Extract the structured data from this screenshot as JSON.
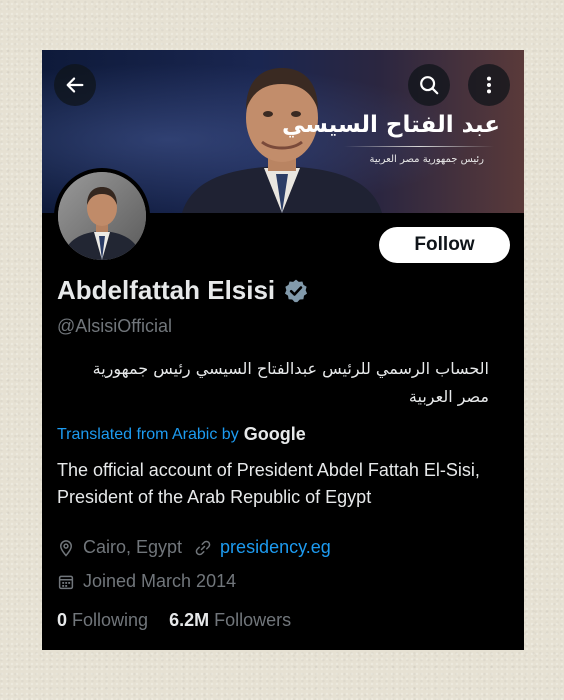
{
  "header": {
    "back_icon": "arrow-left-icon",
    "search_icon": "search-icon",
    "more_icon": "more-vertical-icon"
  },
  "banner": {
    "name_ar": "عبد الفتاح السيسي",
    "subtitle_ar": "رئيس جمهورية مصر العربية"
  },
  "profile": {
    "display_name": "Abdelfattah Elsisi",
    "verified_icon": "verified-badge-icon",
    "handle": "@AlsisiOfficial",
    "follow_label": "Follow",
    "bio_ar": "الحساب الرسمي للرئيس عبدالفتاح السيسي رئيس جمهورية مصر العربية",
    "translated_label": "Translated from Arabic by",
    "translator": "Google",
    "bio_en": "The official account of President Abdel Fattah El-Sisi, President of the Arab Republic of Egypt",
    "location_icon": "location-pin-icon",
    "location": "Cairo, Egypt",
    "link_icon": "link-icon",
    "website": "presidency.eg",
    "calendar_icon": "calendar-icon",
    "joined": "Joined March 2014",
    "following_count": "0",
    "following_label": "Following",
    "followers_count": "6.2M",
    "followers_label": "Followers"
  },
  "colors": {
    "background": "#000000",
    "primary_text": "#e7e9ea",
    "secondary_text": "#71767b",
    "link": "#1d9bf0",
    "verified_badge": "#829aab",
    "follow_button": "#ffffff"
  }
}
